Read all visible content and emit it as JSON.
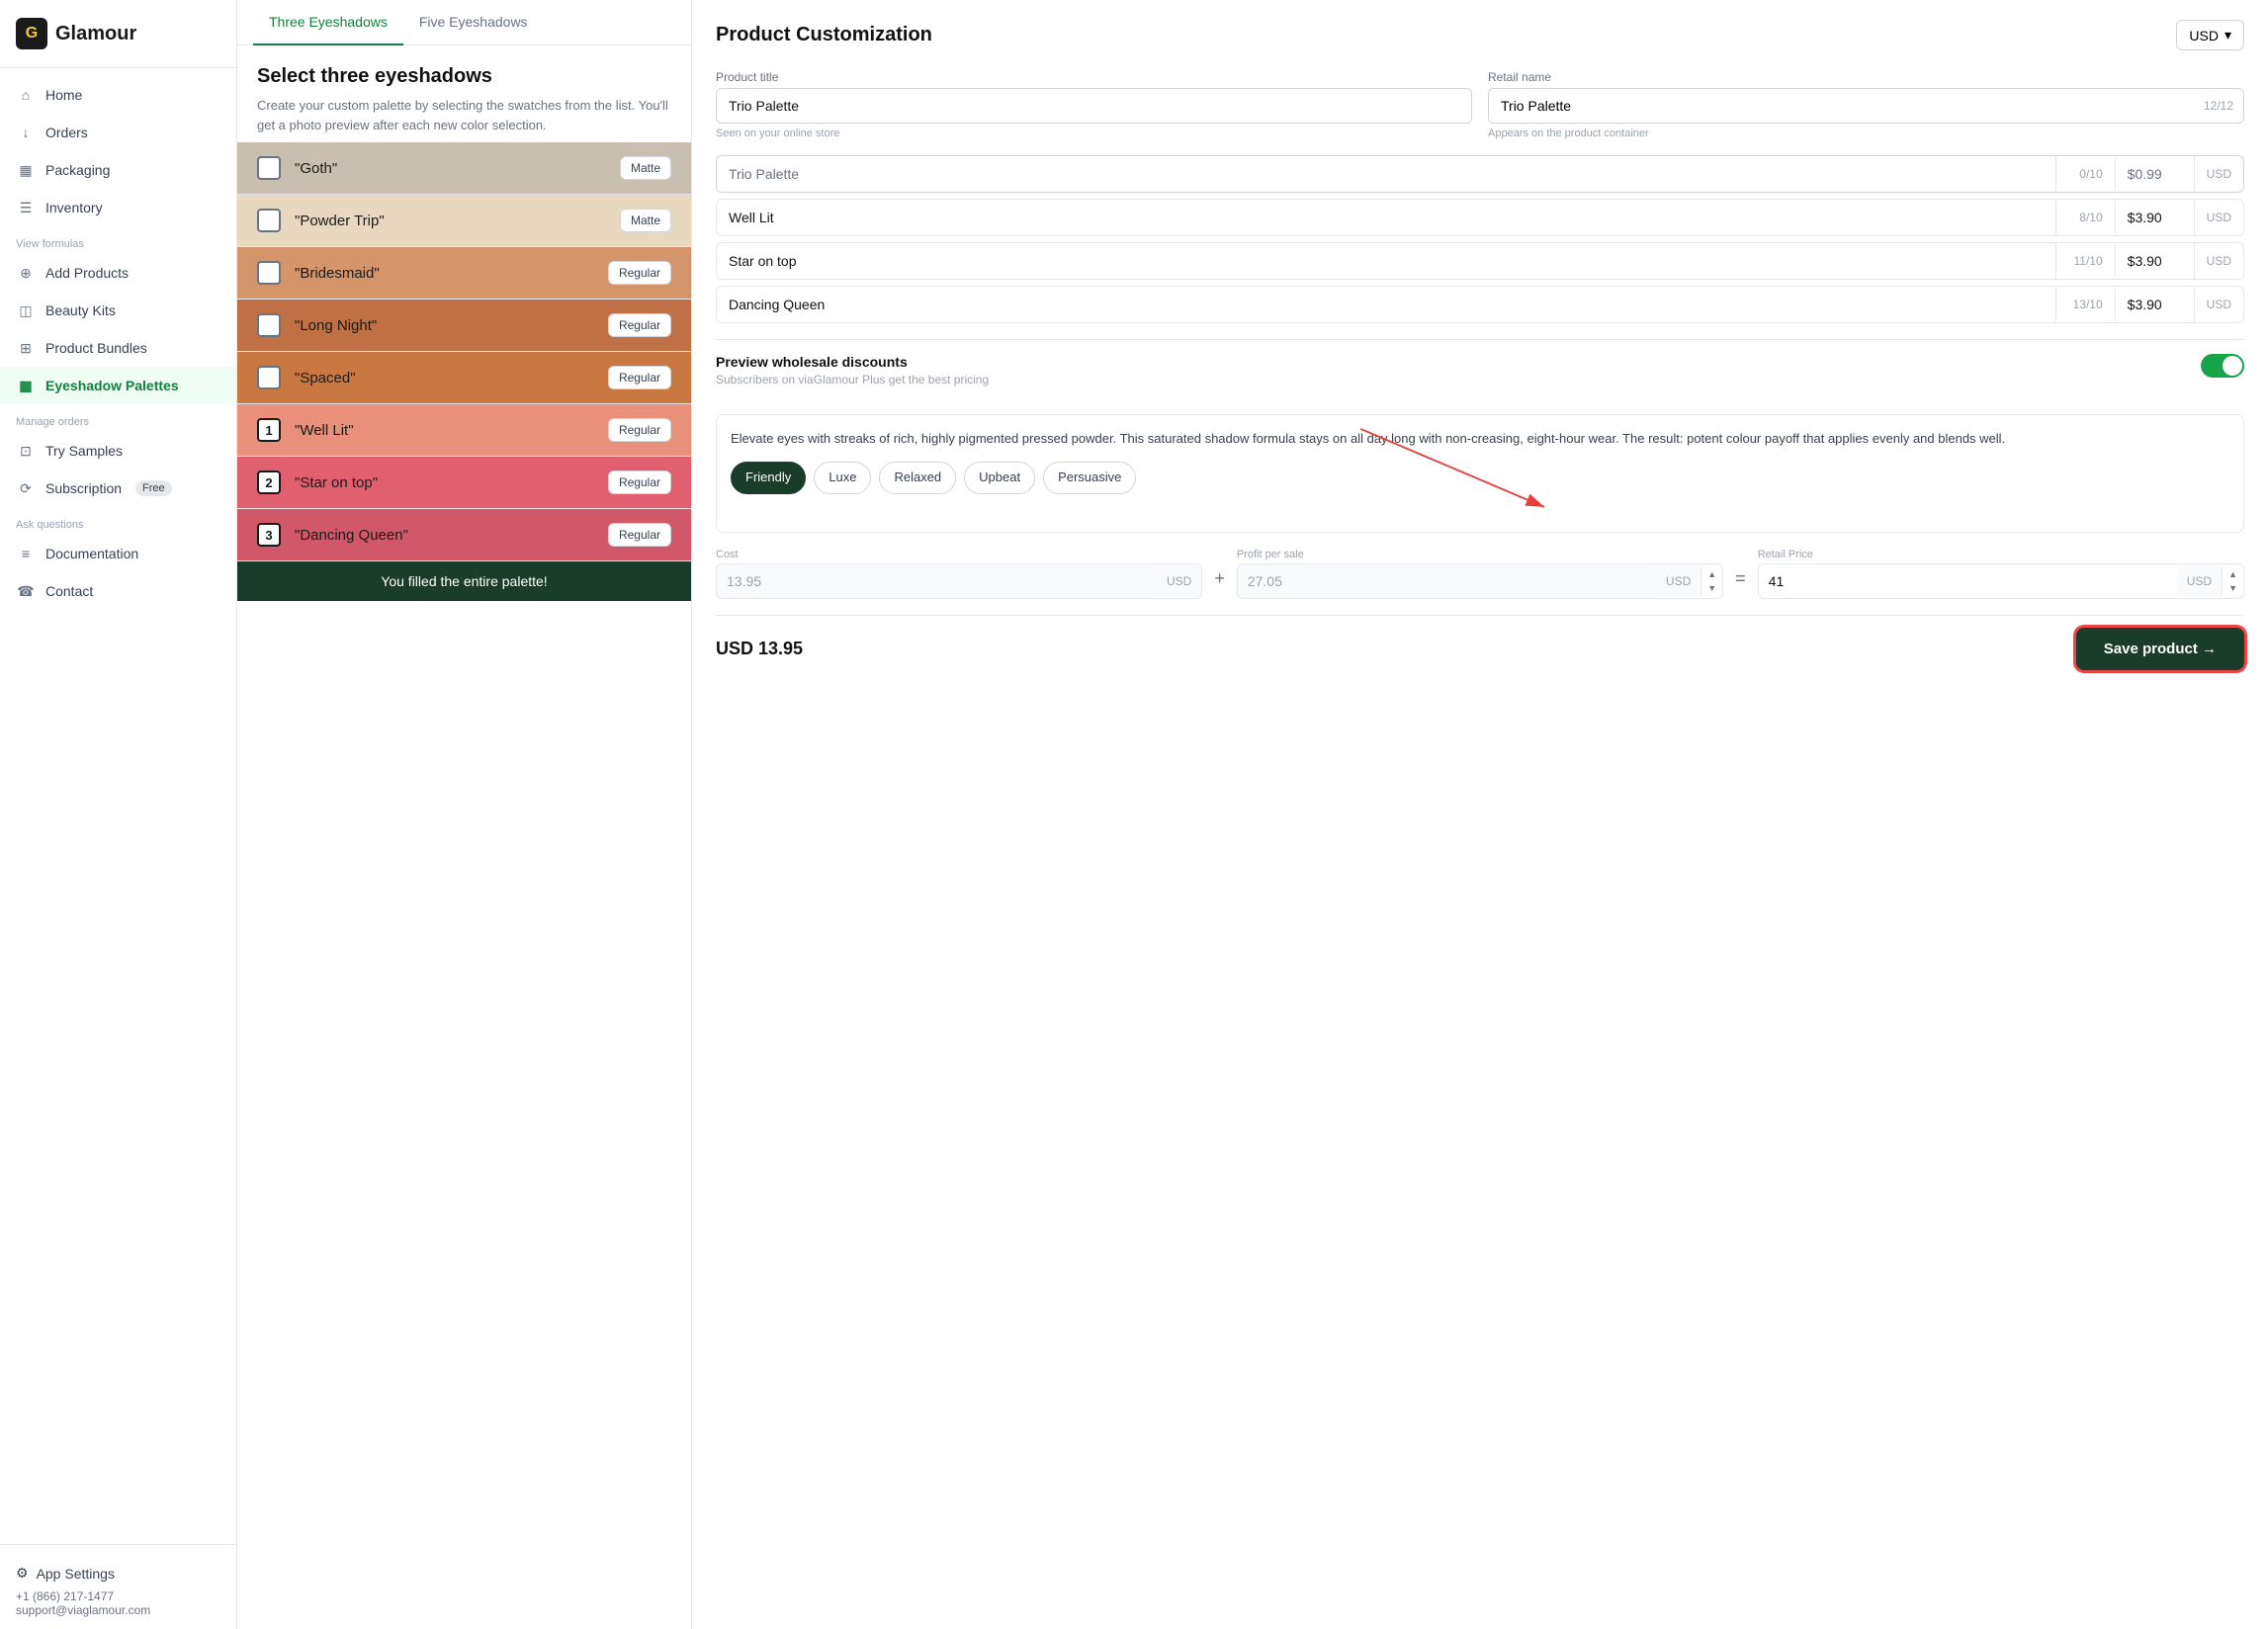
{
  "app": {
    "name": "Glamour",
    "logo_char": "G"
  },
  "sidebar": {
    "nav_items": [
      {
        "id": "home",
        "label": "Home",
        "icon": "home"
      },
      {
        "id": "orders",
        "label": "Orders",
        "icon": "orders"
      },
      {
        "id": "packaging",
        "label": "Packaging",
        "icon": "packaging"
      },
      {
        "id": "inventory",
        "label": "Inventory",
        "icon": "inventory"
      }
    ],
    "section_formulas": "View formulas",
    "formula_items": [
      {
        "id": "add-products",
        "label": "Add Products",
        "icon": "add"
      },
      {
        "id": "beauty-kits",
        "label": "Beauty Kits",
        "icon": "beauty"
      },
      {
        "id": "product-bundles",
        "label": "Product Bundles",
        "icon": "bundle"
      },
      {
        "id": "eyeshadow-palettes",
        "label": "Eyeshadow Palettes",
        "icon": "palette",
        "active": true
      }
    ],
    "section_orders": "Manage orders",
    "order_items": [
      {
        "id": "try-samples",
        "label": "Try Samples",
        "icon": "samples"
      },
      {
        "id": "subscription",
        "label": "Subscription",
        "icon": "subscription",
        "badge": "Free"
      }
    ],
    "section_questions": "Ask questions",
    "question_items": [
      {
        "id": "documentation",
        "label": "Documentation",
        "icon": "docs"
      },
      {
        "id": "contact",
        "label": "Contact",
        "icon": "contact"
      }
    ],
    "settings_label": "App Settings",
    "footer_phone": "+1 (866) 217-1477",
    "footer_email": "support@viaglamour.com"
  },
  "tabs": [
    {
      "id": "three",
      "label": "Three Eyeshadows",
      "active": true
    },
    {
      "id": "five",
      "label": "Five Eyeshadows",
      "active": false
    }
  ],
  "shade_list": {
    "title": "Select three eyeshadows",
    "description": "Create your custom palette by selecting the swatches from the list. You'll get a photo preview after each new color selection.",
    "shades": [
      {
        "id": "goth",
        "name": "\"Goth\"",
        "type": "Matte",
        "selected": false,
        "number": "",
        "css_class": "goth"
      },
      {
        "id": "powder-trip",
        "name": "\"Powder Trip\"",
        "type": "Matte",
        "selected": false,
        "number": "",
        "css_class": "powder-trip"
      },
      {
        "id": "bridesmaid",
        "name": "\"Bridesmaid\"",
        "type": "Regular",
        "selected": false,
        "number": "",
        "css_class": "bridesmaid"
      },
      {
        "id": "long-night",
        "name": "\"Long Night\"",
        "type": "Regular",
        "selected": false,
        "number": "",
        "css_class": "long-night"
      },
      {
        "id": "spaced",
        "name": "\"Spaced\"",
        "type": "Regular",
        "selected": false,
        "number": "",
        "css_class": "spaced"
      },
      {
        "id": "well-lit",
        "name": "\"Well Lit\"",
        "type": "Regular",
        "selected": true,
        "number": "1",
        "css_class": "well-lit"
      },
      {
        "id": "star-on-top",
        "name": "\"Star on top\"",
        "type": "Regular",
        "selected": true,
        "number": "2",
        "css_class": "star-on-top"
      },
      {
        "id": "dancing-queen",
        "name": "\"Dancing Queen\"",
        "type": "Regular",
        "selected": true,
        "number": "3",
        "css_class": "dancing-queen"
      }
    ],
    "filled_banner": "You filled the entire palette!"
  },
  "product_customization": {
    "title": "Product Customization",
    "currency": "USD",
    "product_title_label": "Product title",
    "product_title_value": "Trio Palette",
    "product_title_hint": "Seen on your online store",
    "retail_name_label": "Retail name",
    "retail_name_value": "Trio Palette",
    "retail_name_count": "12/12",
    "retail_name_hint": "Appears on the product container",
    "pricing_rows": [
      {
        "name": "Trio Palette",
        "count": "0/10",
        "price": "$0.99",
        "currency": "USD",
        "filled": false
      },
      {
        "name": "Well Lit",
        "count": "8/10",
        "price": "$3.90",
        "currency": "USD",
        "filled": true
      },
      {
        "name": "Star on top",
        "count": "11/10",
        "price": "$3.90",
        "currency": "USD",
        "filled": true
      },
      {
        "name": "Dancing Queen",
        "count": "13/10",
        "price": "$3.90",
        "currency": "USD",
        "filled": true
      }
    ],
    "discount_label": "Preview wholesale discounts",
    "discount_hint": "Subscribers on viaGlamour Plus get the best pricing",
    "discount_enabled": true,
    "description_text": "Elevate eyes with streaks of rich, highly pigmented pressed powder. This saturated shadow formula stays on all day long with non-creasing, eight-hour wear. The result: potent colour payoff that applies evenly and blends well.",
    "tone_tags": [
      {
        "id": "friendly",
        "label": "Friendly",
        "active": true
      },
      {
        "id": "luxe",
        "label": "Luxe",
        "active": false
      },
      {
        "id": "relaxed",
        "label": "Relaxed",
        "active": false
      },
      {
        "id": "upbeat",
        "label": "Upbeat",
        "active": false
      },
      {
        "id": "persuasive",
        "label": "Persuasive",
        "active": false
      }
    ],
    "cost_label": "Cost",
    "cost_value": "13.95",
    "cost_currency": "USD",
    "profit_label": "Profit per sale",
    "profit_value": "27.05",
    "profit_currency": "USD",
    "retail_label": "Retail Price",
    "retail_value": "41",
    "retail_currency": "USD",
    "total_label": "USD 13.95",
    "save_button_label": "Save product →"
  }
}
